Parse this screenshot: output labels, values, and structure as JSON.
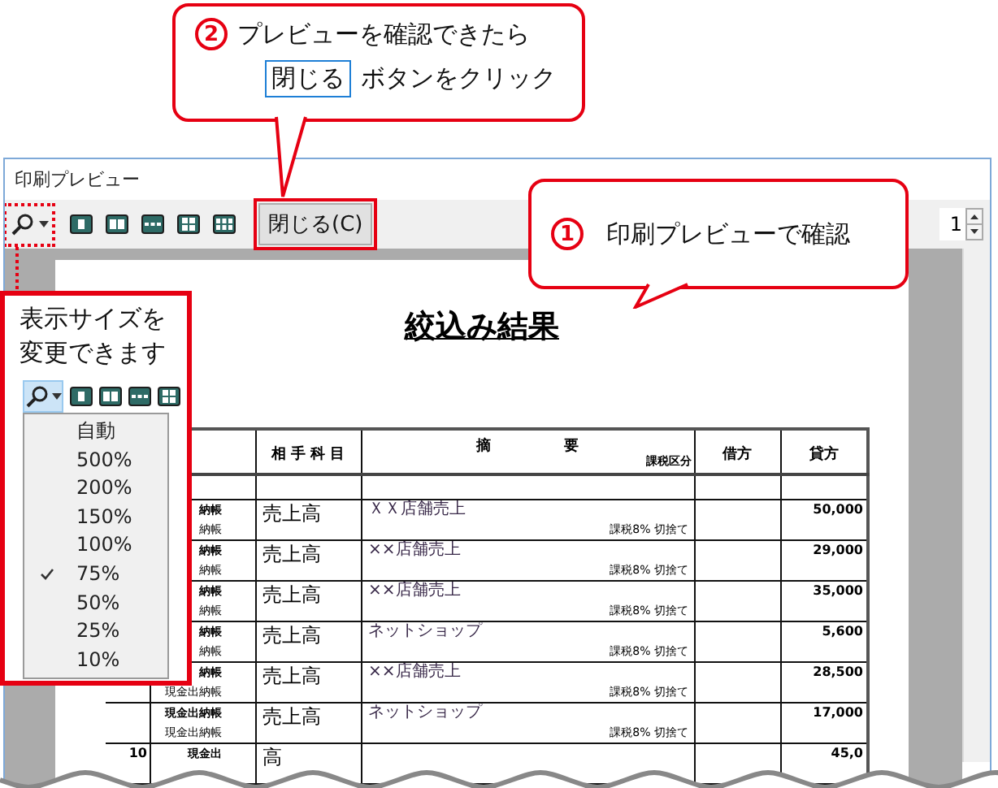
{
  "top_callout": {
    "number": "2",
    "line_1": "プレビューを確認できたら",
    "highlight": "閉じる",
    "line_2": "ボタンをクリック"
  },
  "window": {
    "title": "印刷プレビュー"
  },
  "toolbar": {
    "close_button": "閉じる(C)",
    "page_number": "1"
  },
  "right_callout": {
    "number": "1",
    "text": "印刷プレビューで確認"
  },
  "zoom_callout": {
    "text": "表示サイズを変更できます",
    "menu": [
      {
        "label": "自動",
        "checked": false
      },
      {
        "label": "500%",
        "checked": false
      },
      {
        "label": "200%",
        "checked": false
      },
      {
        "label": "150%",
        "checked": false
      },
      {
        "label": "100%",
        "checked": false
      },
      {
        "label": "75%",
        "checked": true
      },
      {
        "label": "50%",
        "checked": false
      },
      {
        "label": "25%",
        "checked": false
      },
      {
        "label": "10%",
        "checked": false
      }
    ]
  },
  "page": {
    "title": "絞込み結果",
    "table": {
      "columns": [
        {
          "label": "相 手 科 目"
        },
        {
          "label": "摘　　　　　要",
          "sublabel": "課税区分"
        },
        {
          "label": "借方"
        },
        {
          "label": "貸方"
        }
      ],
      "rows": [
        {
          "book_top": "納帳",
          "book_bottom": "納帳",
          "account": "売上高",
          "description": "ＸＸ店舗売上",
          "tax": "課税8% 切捨て",
          "credit": "50,000"
        },
        {
          "book_top": "納帳",
          "book_bottom": "納帳",
          "account": "売上高",
          "description": "××店舗売上",
          "tax": "課税8% 切捨て",
          "credit": "29,000"
        },
        {
          "book_top": "納帳",
          "book_bottom": "納帳",
          "account": "売上高",
          "description": "××店舗売上",
          "tax": "課税8% 切捨て",
          "credit": "35,000"
        },
        {
          "book_top": "納帳",
          "book_bottom": "納帳",
          "account": "売上高",
          "description": "ネットショップ",
          "tax": "課税8% 切捨て",
          "credit": "5,600"
        },
        {
          "book_top": "納帳",
          "book_bottom": "現金出納帳",
          "account": "売上高",
          "description": "××店舗売上",
          "tax": "課税8% 切捨て",
          "credit": "28,500"
        },
        {
          "book_top": "現金出納帳",
          "book_bottom": "現金出納帳",
          "account": "売上高",
          "description": "ネットショップ",
          "tax": "課税8% 切捨て",
          "credit": "17,000"
        },
        {
          "date": "10",
          "book_top": "現金出",
          "account": "高",
          "credit": "45,0"
        }
      ]
    }
  }
}
